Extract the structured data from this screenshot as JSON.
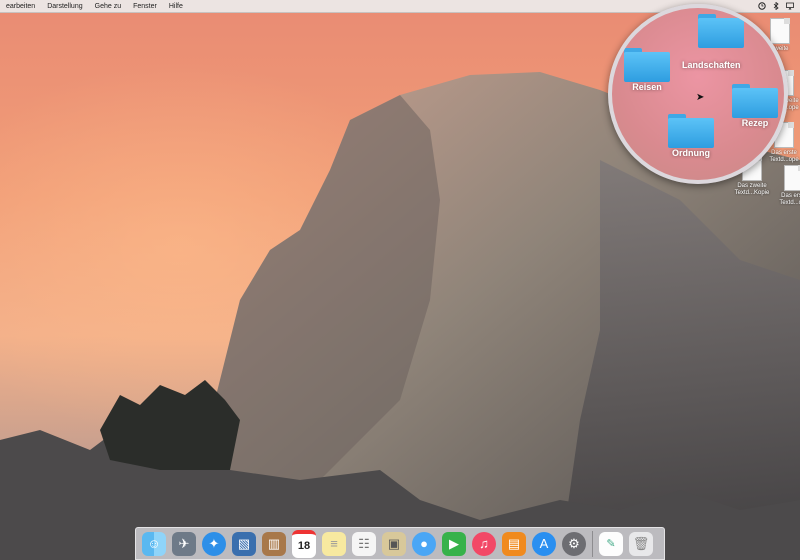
{
  "menubar": {
    "items": [
      "earbeiten",
      "Darstellung",
      "Gehe zu",
      "Fenster",
      "Hilfe"
    ]
  },
  "magnifier": {
    "folders": [
      "Landschaften",
      "Reisen",
      "Rezep",
      "Ordnung"
    ]
  },
  "desktop_files": [
    "zweite",
    "Das zweite Textd...ope",
    "Das erste Textd...ope",
    "Das zweite Textd...Kopie",
    "Das erste Textd...ope",
    "Te"
  ],
  "dock": {
    "calendar_day": "18",
    "icons": [
      "finder-icon",
      "launchpad-icon",
      "safari-icon",
      "photo-icon",
      "contacts-icon",
      "calendar-icon",
      "notes-icon",
      "reminders-icon",
      "preview-icon",
      "messages-icon",
      "facetime-icon",
      "itunes-icon",
      "ibooks-icon",
      "appstore-icon",
      "system-preferences-icon",
      "document-icon",
      "trash-icon"
    ]
  }
}
